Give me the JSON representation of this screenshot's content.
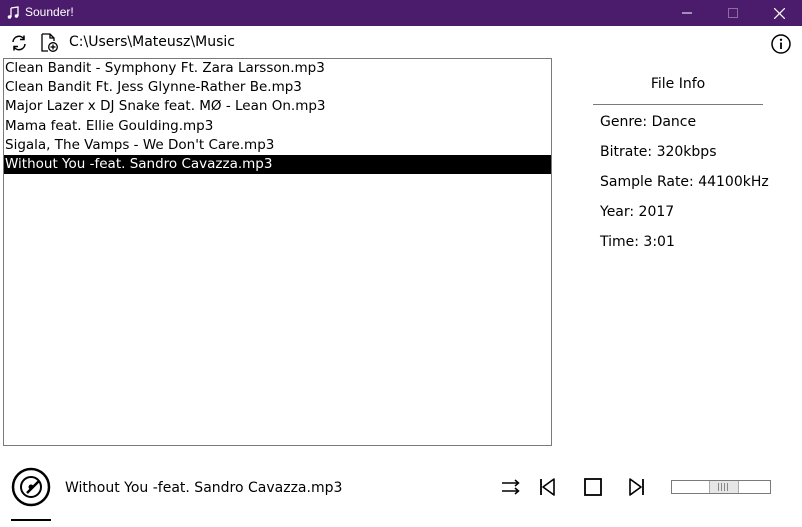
{
  "window": {
    "title": "Sounder!",
    "app_icon": "music-note-icon",
    "accent_color": "#4b1c6b"
  },
  "toolbar": {
    "refresh_icon": "refresh-icon",
    "add_file_icon": "add-file-icon",
    "path": "C:\\Users\\Mateusz\\Music",
    "info_icon": "info-icon"
  },
  "files": [
    "Clean Bandit - Symphony Ft. Zara Larsson.mp3",
    "Clean Bandit Ft. Jess Glynne-Rather Be.mp3",
    "Major Lazer x DJ Snake feat. MØ - Lean On.mp3",
    "Mama feat. Ellie Goulding.mp3",
    "Sigala, The Vamps - We Don't Care.mp3",
    "Without You -feat. Sandro Cavazza.mp3"
  ],
  "selected_index": 5,
  "file_info": {
    "heading": "File Info",
    "genre": "Genre: Dance",
    "bitrate": "Bitrate: 320kbps",
    "sample_rate": "Sample Rate: 44100kHz",
    "year": "Year: 2017",
    "time": "Time: 3:01"
  },
  "player": {
    "now_playing": "Without You -feat. Sandro Cavazza.mp3",
    "volume_fraction": 0.5
  }
}
